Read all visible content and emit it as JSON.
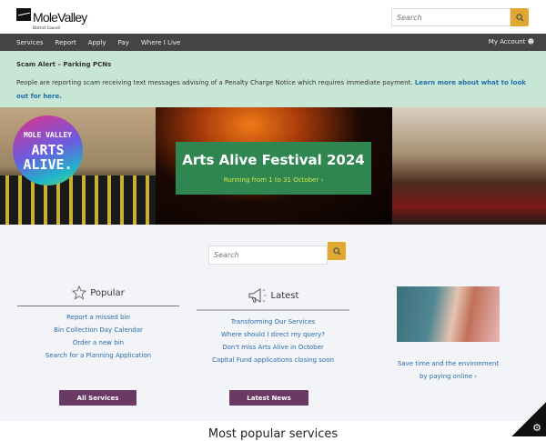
{
  "header": {
    "logo_name": "MoleValley",
    "logo_sub": "District Council",
    "search_placeholder": "Search"
  },
  "nav": {
    "items": [
      "Services",
      "Report",
      "Apply",
      "Pay",
      "Where I Live"
    ],
    "account": "My Account"
  },
  "alert": {
    "title": "Scam Alert – Parking PCNs",
    "body": "People are reporting scam receiving text messages advising of a Penalty Charge Notice which requires immediate payment. ",
    "link": "Learn more about what to look out for here."
  },
  "hero": {
    "badge_line1": "MOLE VALLEY",
    "badge_line2": "ARTS",
    "badge_line3": "ALIVE.",
    "title": "Arts Alive Festival 2024",
    "subtitle": "Running from 1 to 31 October ›"
  },
  "main": {
    "search_placeholder": "Search",
    "popular": {
      "title": "Popular",
      "links": [
        "Report a missed bin",
        "Bin Collection Day Calendar",
        "Order a new bin",
        "Search for a Planning Application"
      ],
      "button": "All Services"
    },
    "latest": {
      "title": "Latest",
      "links": [
        "Transforming Our Services",
        "Where should I direct my query?",
        "Don't miss Arts Alive in October",
        "Capital Fund applications closing soon"
      ],
      "button": "Latest News"
    },
    "promo": {
      "line1": "Save time and the environment",
      "line2": "by paying online ›"
    }
  },
  "bottom": {
    "title": "Most popular services"
  },
  "colors": {
    "accent": "#e0a82e",
    "nav": "#444444",
    "alert": "#c8e6d6",
    "hero_box": "#2f8650",
    "button": "#6b3a64",
    "link": "#2a6aaa"
  }
}
